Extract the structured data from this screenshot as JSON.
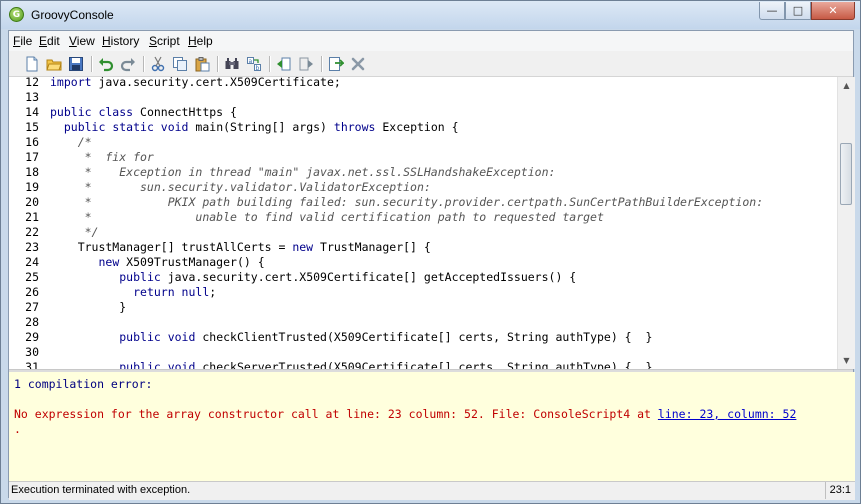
{
  "window": {
    "title": "GroovyConsole",
    "icon_letter": "G",
    "minimize_glyph": "—",
    "maximize_glyph": "□",
    "close_glyph": "✕"
  },
  "menu": [
    {
      "first": "F",
      "rest": "ile"
    },
    {
      "first": "E",
      "rest": "dit"
    },
    {
      "first": "V",
      "rest": "iew"
    },
    {
      "first": "H",
      "rest": "istory"
    },
    {
      "first": "S",
      "rest": "cript"
    },
    {
      "first": "H",
      "rest": "elp"
    }
  ],
  "toolbar": {
    "icons": [
      "new-document-icon",
      "open-folder-icon",
      "save-icon",
      "undo-icon",
      "redo-icon",
      "cut-icon",
      "copy-icon",
      "paste-icon",
      "find-icon",
      "find-replace-icon",
      "history-previous-icon",
      "history-next-icon",
      "run-script-icon",
      "interrupt-icon"
    ]
  },
  "editor": {
    "lines": [
      {
        "n": "12",
        "segs": [
          {
            "t": "import ",
            "c": "kw"
          },
          {
            "t": "java.security.cert.X509Certificate;",
            "c": ""
          }
        ]
      },
      {
        "n": "13",
        "segs": []
      },
      {
        "n": "14",
        "segs": [
          {
            "t": "public class ",
            "c": "kw"
          },
          {
            "t": "ConnectHttps {",
            "c": ""
          }
        ]
      },
      {
        "n": "15",
        "segs": [
          {
            "t": "  ",
            "c": ""
          },
          {
            "t": "public static void ",
            "c": "kw"
          },
          {
            "t": "main",
            "c": "kwb"
          },
          {
            "t": "(String[] args) ",
            "c": ""
          },
          {
            "t": "throws ",
            "c": "kw"
          },
          {
            "t": "Exception {",
            "c": ""
          }
        ]
      },
      {
        "n": "16",
        "segs": [
          {
            "t": "    /*",
            "c": "cm"
          }
        ]
      },
      {
        "n": "17",
        "segs": [
          {
            "t": "     *  fix for",
            "c": "cm"
          }
        ]
      },
      {
        "n": "18",
        "segs": [
          {
            "t": "     *    Exception in thread \"main\" javax.net.ssl.SSLHandshakeException:",
            "c": "cm"
          }
        ]
      },
      {
        "n": "19",
        "segs": [
          {
            "t": "     *       sun.security.validator.ValidatorException:",
            "c": "cm"
          }
        ]
      },
      {
        "n": "20",
        "segs": [
          {
            "t": "     *           PKIX path building failed: sun.security.provider.certpath.SunCertPathBuilderException:",
            "c": "cm"
          }
        ]
      },
      {
        "n": "21",
        "segs": [
          {
            "t": "     *               unable to find valid certification path to requested target",
            "c": "cm"
          }
        ]
      },
      {
        "n": "22",
        "segs": [
          {
            "t": "     */",
            "c": "cm"
          }
        ]
      },
      {
        "n": "23",
        "segs": [
          {
            "t": "    TrustManager[] trustAllCerts = ",
            "c": ""
          },
          {
            "t": "new ",
            "c": "kw"
          },
          {
            "t": "TrustManager[] {",
            "c": ""
          }
        ]
      },
      {
        "n": "24",
        "segs": [
          {
            "t": "       ",
            "c": ""
          },
          {
            "t": "new ",
            "c": "kw"
          },
          {
            "t": "X509TrustManager",
            "c": "kwb"
          },
          {
            "t": "() {",
            "c": ""
          }
        ]
      },
      {
        "n": "25",
        "segs": [
          {
            "t": "          ",
            "c": ""
          },
          {
            "t": "public ",
            "c": "kw"
          },
          {
            "t": "java.security.cert.X509Certificate[] ",
            "c": ""
          },
          {
            "t": "getAcceptedIssuers",
            "c": "kwb"
          },
          {
            "t": "() {",
            "c": ""
          }
        ]
      },
      {
        "n": "26",
        "segs": [
          {
            "t": "            ",
            "c": ""
          },
          {
            "t": "return null",
            "c": "kw"
          },
          {
            "t": ";",
            "c": ""
          }
        ]
      },
      {
        "n": "27",
        "segs": [
          {
            "t": "          }",
            "c": ""
          }
        ]
      },
      {
        "n": "28",
        "segs": []
      },
      {
        "n": "29",
        "segs": [
          {
            "t": "          ",
            "c": ""
          },
          {
            "t": "public void ",
            "c": "kw"
          },
          {
            "t": "checkClientTrusted",
            "c": "kwb"
          },
          {
            "t": "(X509Certificate[] certs, String authType) {  }",
            "c": ""
          }
        ]
      },
      {
        "n": "30",
        "segs": []
      },
      {
        "n": "31",
        "segs": [
          {
            "t": "          ",
            "c": ""
          },
          {
            "t": "public void ",
            "c": "kw"
          },
          {
            "t": "checkServerTrusted",
            "c": "kwb"
          },
          {
            "t": "(X509Certificate[] certs, String authType) {  }",
            "c": ""
          }
        ]
      }
    ]
  },
  "output": {
    "header": "1 compilation error:",
    "error_text": "No expression for the array constructor call at line: 23 column: 52. File: ConsoleScript4 at ",
    "error_link": "line: 23, column: 52",
    "trailing": "."
  },
  "status": {
    "message": "Execution terminated with exception.",
    "caret_position": "23:1"
  }
}
